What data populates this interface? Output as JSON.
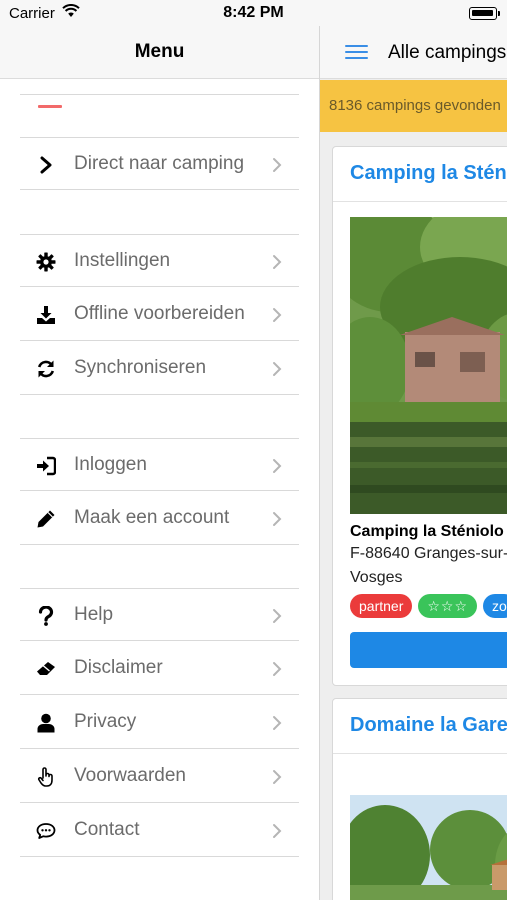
{
  "status_bar": {
    "carrier": "Carrier",
    "time": "8:42 PM"
  },
  "menu": {
    "title": "Menu",
    "items": [
      {
        "label": "Direct naar camping",
        "icon": "chevron-right-icon"
      },
      {
        "label": "Instellingen",
        "icon": "gear-icon"
      },
      {
        "label": "Offline voorbereiden",
        "icon": "download-icon"
      },
      {
        "label": "Synchroniseren",
        "icon": "sync-icon"
      },
      {
        "label": "Inloggen",
        "icon": "sign-in-icon"
      },
      {
        "label": "Maak een account",
        "icon": "pencil-icon"
      },
      {
        "label": "Help",
        "icon": "question-icon"
      },
      {
        "label": "Disclaimer",
        "icon": "eraser-icon"
      },
      {
        "label": "Privacy",
        "icon": "user-icon"
      },
      {
        "label": "Voorwaarden",
        "icon": "hand-pointer-icon"
      },
      {
        "label": "Contact",
        "icon": "chat-bubble-icon"
      }
    ]
  },
  "content": {
    "title": "Alle campings",
    "result_count": "8136 campings gevonden",
    "cards": [
      {
        "title": "Camping la Sténiolo",
        "name": "Camping la Sténiolo",
        "address": "F-88640  Granges-sur-",
        "region": "Vosges",
        "badges": [
          "partner",
          "☆☆☆",
          "zo"
        ]
      },
      {
        "title": "Domaine la Gare"
      }
    ]
  },
  "colors": {
    "accent_blue": "#1e88e5",
    "banner_yellow": "#f6c342",
    "partner_red": "#eb3b3b",
    "stars_green": "#3ac45a"
  }
}
